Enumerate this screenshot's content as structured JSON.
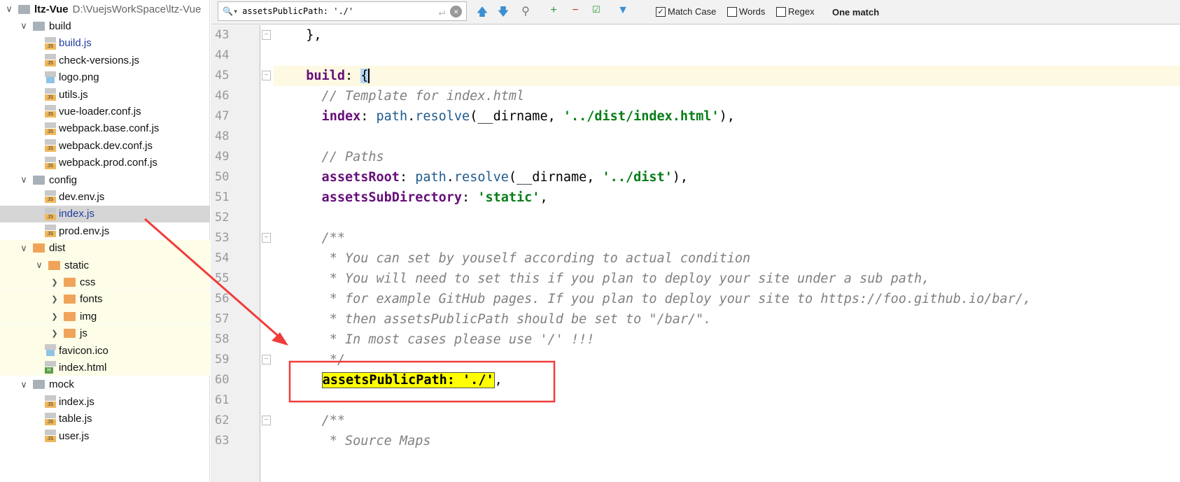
{
  "tree": [
    {
      "label": "ltz-Vue",
      "path": "D:\\VuejsWorkSpace\\ltz-Vue",
      "type": "folder",
      "level": 0,
      "open": true
    },
    {
      "label": "build",
      "type": "folder",
      "level": 1,
      "open": true
    },
    {
      "label": "build.js",
      "type": "js",
      "level": 2,
      "modified": true
    },
    {
      "label": "check-versions.js",
      "type": "js",
      "level": 2
    },
    {
      "label": "logo.png",
      "type": "img",
      "level": 2
    },
    {
      "label": "utils.js",
      "type": "js",
      "level": 2
    },
    {
      "label": "vue-loader.conf.js",
      "type": "js",
      "level": 2
    },
    {
      "label": "webpack.base.conf.js",
      "type": "js",
      "level": 2
    },
    {
      "label": "webpack.dev.conf.js",
      "type": "js",
      "level": 2
    },
    {
      "label": "webpack.prod.conf.js",
      "type": "js",
      "level": 2
    },
    {
      "label": "config",
      "type": "folder",
      "level": 1,
      "open": true
    },
    {
      "label": "dev.env.js",
      "type": "js",
      "level": 2
    },
    {
      "label": "index.js",
      "type": "js",
      "level": 2,
      "selected": true,
      "modified": true
    },
    {
      "label": "prod.env.js",
      "type": "js",
      "level": 2
    },
    {
      "label": "dist",
      "type": "folder-o",
      "level": 1,
      "open": true,
      "excluded": true
    },
    {
      "label": "static",
      "type": "folder-o",
      "level": 2,
      "open": true,
      "excluded": true
    },
    {
      "label": "css",
      "type": "folder-o",
      "level": 3,
      "open": false,
      "excluded": true
    },
    {
      "label": "fonts",
      "type": "folder-o",
      "level": 3,
      "open": false,
      "excluded": true
    },
    {
      "label": "img",
      "type": "folder-o",
      "level": 3,
      "open": false,
      "excluded": true
    },
    {
      "label": "js",
      "type": "folder-o",
      "level": 3,
      "open": false,
      "excluded": true
    },
    {
      "label": "favicon.ico",
      "type": "img",
      "level": 2,
      "excluded": true
    },
    {
      "label": "index.html",
      "type": "html",
      "level": 2,
      "excluded": true
    },
    {
      "label": "mock",
      "type": "folder",
      "level": 1,
      "open": true
    },
    {
      "label": "index.js",
      "type": "js",
      "level": 2
    },
    {
      "label": "table.js",
      "type": "js",
      "level": 2
    },
    {
      "label": "user.js",
      "type": "js",
      "level": 2
    }
  ],
  "find": {
    "query": "assetsPublicPath: './'",
    "match_case": {
      "label": "Match Case",
      "checked": true
    },
    "words": {
      "label": "Words",
      "checked": false
    },
    "regex": {
      "label": "Regex",
      "checked": false
    },
    "status": "One match"
  },
  "editor": {
    "current_line": 45,
    "highlight_color": "#ffff00",
    "lines": [
      {
        "n": "43",
        "tokens": [
          [
            "p",
            "  },"
          ]
        ]
      },
      {
        "n": "44",
        "tokens": []
      },
      {
        "n": "45",
        "tokens": [
          [
            "k",
            "  build"
          ],
          [
            "p",
            ": "
          ],
          [
            "p",
            "{"
          ]
        ]
      },
      {
        "n": "46",
        "tokens": [
          [
            "c",
            "    // Template for index.html"
          ]
        ]
      },
      {
        "n": "47",
        "tokens": [
          [
            "k",
            "    index"
          ],
          [
            "p",
            ": "
          ],
          [
            "m",
            "path"
          ],
          [
            "p",
            "."
          ],
          [
            "m",
            "resolve"
          ],
          [
            "p",
            "(__dirname, "
          ],
          [
            "s",
            "'../dist/index.html'"
          ],
          [
            "p",
            "),"
          ]
        ]
      },
      {
        "n": "48",
        "tokens": []
      },
      {
        "n": "49",
        "tokens": [
          [
            "c",
            "    // Paths"
          ]
        ]
      },
      {
        "n": "50",
        "tokens": [
          [
            "k",
            "    assetsRoot"
          ],
          [
            "p",
            ": "
          ],
          [
            "m",
            "path"
          ],
          [
            "p",
            "."
          ],
          [
            "m",
            "resolve"
          ],
          [
            "p",
            "(__dirname, "
          ],
          [
            "s",
            "'../dist'"
          ],
          [
            "p",
            "),"
          ]
        ]
      },
      {
        "n": "51",
        "tokens": [
          [
            "k",
            "    assetsSubDirectory"
          ],
          [
            "p",
            ": "
          ],
          [
            "s",
            "'static'"
          ],
          [
            "p",
            ","
          ]
        ]
      },
      {
        "n": "52",
        "tokens": []
      },
      {
        "n": "53",
        "tokens": [
          [
            "c",
            "    /**"
          ]
        ]
      },
      {
        "n": "54",
        "tokens": [
          [
            "c",
            "     * You can set by youself according to actual condition"
          ]
        ]
      },
      {
        "n": "55",
        "tokens": [
          [
            "c",
            "     * You will need to set this if you plan to deploy your site under a sub path,"
          ]
        ]
      },
      {
        "n": "56",
        "tokens": [
          [
            "c",
            "     * for example GitHub pages. If you plan to deploy your site to https://foo.github.io/bar/,"
          ]
        ]
      },
      {
        "n": "57",
        "tokens": [
          [
            "c",
            "     * then assetsPublicPath should be set to \"/bar/\"."
          ]
        ]
      },
      {
        "n": "58",
        "tokens": [
          [
            "c",
            "     * In most cases please use '/' !!!"
          ]
        ]
      },
      {
        "n": "59",
        "tokens": [
          [
            "c",
            "     */"
          ]
        ]
      },
      {
        "n": "60",
        "tokens": [
          [
            "p",
            "    "
          ],
          [
            "hl",
            "assetsPublicPath: './'"
          ],
          [
            "p",
            ","
          ]
        ]
      },
      {
        "n": "61",
        "tokens": []
      },
      {
        "n": "62",
        "tokens": [
          [
            "c",
            "    /**"
          ]
        ]
      },
      {
        "n": "63",
        "tokens": [
          [
            "c",
            "     * Source Maps"
          ]
        ]
      }
    ]
  }
}
